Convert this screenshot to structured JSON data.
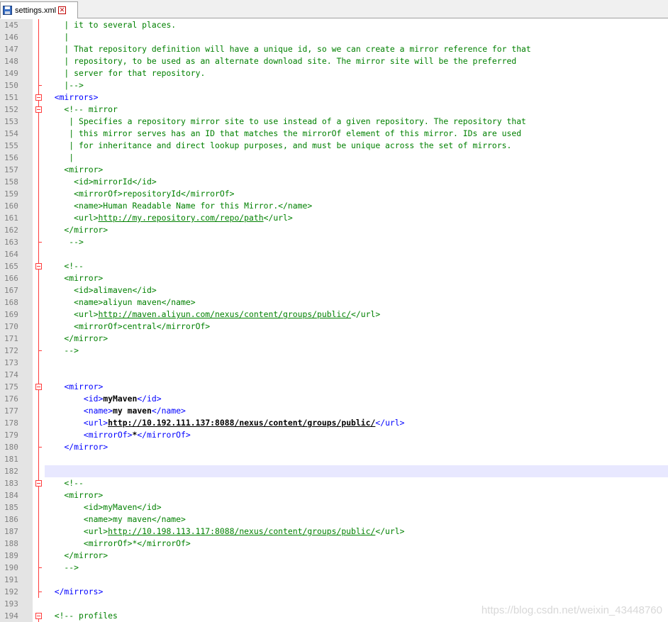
{
  "tab": {
    "filename": "settings.xml",
    "icon": "save-disk-icon",
    "close_icon": "close-icon"
  },
  "watermark": "https://blog.csdn.net/weixin_43448760",
  "colors": {
    "comment": "#008000",
    "tag": "#0000ff",
    "text": "#000000",
    "fold": "#ff3b3b",
    "current_line": "#e8e8ff",
    "gutter_bg": "#e4e4e4",
    "line_number": "#808080"
  },
  "lines": [
    {
      "n": "145",
      "fold": "line",
      "segs": [
        {
          "t": "    | it to several places.",
          "k": "c"
        }
      ]
    },
    {
      "n": "146",
      "fold": "line",
      "segs": [
        {
          "t": "    |",
          "k": "c"
        }
      ]
    },
    {
      "n": "147",
      "fold": "line",
      "segs": [
        {
          "t": "    | That repository definition will have a unique id, so we can create a mirror reference for that",
          "k": "c"
        }
      ]
    },
    {
      "n": "148",
      "fold": "line",
      "segs": [
        {
          "t": "    | repository, to be used as an alternate download site. The mirror site will be the preferred",
          "k": "c"
        }
      ]
    },
    {
      "n": "149",
      "fold": "line",
      "segs": [
        {
          "t": "    | server for that repository.",
          "k": "c"
        }
      ]
    },
    {
      "n": "150",
      "fold": "end",
      "segs": [
        {
          "t": "    |-->",
          "k": "c"
        }
      ]
    },
    {
      "n": "151",
      "fold": "box",
      "segs": [
        {
          "t": "  ",
          "k": "c"
        },
        {
          "t": "<mirrors>",
          "k": "tag"
        }
      ]
    },
    {
      "n": "152",
      "fold": "box",
      "segs": [
        {
          "t": "    <!-- mirror",
          "k": "c"
        }
      ]
    },
    {
      "n": "153",
      "fold": "line",
      "segs": [
        {
          "t": "     | Specifies a repository mirror site to use instead of a given repository. The repository that",
          "k": "c"
        }
      ]
    },
    {
      "n": "154",
      "fold": "line",
      "segs": [
        {
          "t": "     | this mirror serves has an ID that matches the mirrorOf element of this mirror. IDs are used",
          "k": "c"
        }
      ]
    },
    {
      "n": "155",
      "fold": "line",
      "segs": [
        {
          "t": "     | for inheritance and direct lookup purposes, and must be unique across the set of mirrors.",
          "k": "c"
        }
      ]
    },
    {
      "n": "156",
      "fold": "line",
      "segs": [
        {
          "t": "     |",
          "k": "c"
        }
      ]
    },
    {
      "n": "157",
      "fold": "line",
      "segs": [
        {
          "t": "    <mirror>",
          "k": "c"
        }
      ]
    },
    {
      "n": "158",
      "fold": "line",
      "segs": [
        {
          "t": "      <id>mirrorId</id>",
          "k": "c"
        }
      ]
    },
    {
      "n": "159",
      "fold": "line",
      "segs": [
        {
          "t": "      <mirrorOf>repositoryId</mirrorOf>",
          "k": "c"
        }
      ]
    },
    {
      "n": "160",
      "fold": "line",
      "segs": [
        {
          "t": "      <name>Human Readable Name for this Mirror.</name>",
          "k": "c"
        }
      ]
    },
    {
      "n": "161",
      "fold": "line",
      "segs": [
        {
          "t": "      <url>",
          "k": "c"
        },
        {
          "t": "http://my.repository.com/repo/path",
          "k": "curl"
        },
        {
          "t": "</url>",
          "k": "c"
        }
      ]
    },
    {
      "n": "162",
      "fold": "line",
      "segs": [
        {
          "t": "    </mirror>",
          "k": "c"
        }
      ]
    },
    {
      "n": "163",
      "fold": "end",
      "segs": [
        {
          "t": "     -->",
          "k": "c"
        }
      ]
    },
    {
      "n": "164",
      "fold": "line",
      "segs": [
        {
          "t": "",
          "k": "c"
        }
      ]
    },
    {
      "n": "165",
      "fold": "box",
      "segs": [
        {
          "t": "    <!--",
          "k": "c"
        }
      ]
    },
    {
      "n": "166",
      "fold": "line",
      "segs": [
        {
          "t": "    <mirror>",
          "k": "c"
        }
      ]
    },
    {
      "n": "167",
      "fold": "line",
      "segs": [
        {
          "t": "      <id>alimaven</id>",
          "k": "c"
        }
      ]
    },
    {
      "n": "168",
      "fold": "line",
      "segs": [
        {
          "t": "      <name>aliyun maven</name>",
          "k": "c"
        }
      ]
    },
    {
      "n": "169",
      "fold": "line",
      "segs": [
        {
          "t": "      <url>",
          "k": "c"
        },
        {
          "t": "http://maven.aliyun.com/nexus/content/groups/public/",
          "k": "curl"
        },
        {
          "t": "</url>",
          "k": "c"
        }
      ]
    },
    {
      "n": "170",
      "fold": "line",
      "segs": [
        {
          "t": "      <mirrorOf>central</mirrorOf>",
          "k": "c"
        }
      ]
    },
    {
      "n": "171",
      "fold": "line",
      "segs": [
        {
          "t": "    </mirror>",
          "k": "c"
        }
      ]
    },
    {
      "n": "172",
      "fold": "end",
      "segs": [
        {
          "t": "    -->",
          "k": "c"
        }
      ]
    },
    {
      "n": "173",
      "fold": "line",
      "segs": [
        {
          "t": "",
          "k": "c"
        }
      ]
    },
    {
      "n": "174",
      "fold": "line",
      "segs": [
        {
          "t": "",
          "k": "c"
        }
      ]
    },
    {
      "n": "175",
      "fold": "box",
      "segs": [
        {
          "t": "    ",
          "k": "c"
        },
        {
          "t": "<mirror>",
          "k": "tag"
        }
      ]
    },
    {
      "n": "176",
      "fold": "line",
      "segs": [
        {
          "t": "        ",
          "k": "c"
        },
        {
          "t": "<id>",
          "k": "tag"
        },
        {
          "t": "myMaven",
          "k": "txt"
        },
        {
          "t": "</id>",
          "k": "tag"
        }
      ]
    },
    {
      "n": "177",
      "fold": "line",
      "segs": [
        {
          "t": "        ",
          "k": "c"
        },
        {
          "t": "<name>",
          "k": "tag"
        },
        {
          "t": "my maven",
          "k": "txt"
        },
        {
          "t": "</name>",
          "k": "tag"
        }
      ]
    },
    {
      "n": "178",
      "fold": "line",
      "segs": [
        {
          "t": "        ",
          "k": "c"
        },
        {
          "t": "<url>",
          "k": "tag"
        },
        {
          "t": "http://10.192.111.137:8088/nexus/content/groups/public/",
          "k": "url"
        },
        {
          "t": "</url>",
          "k": "tag"
        }
      ]
    },
    {
      "n": "179",
      "fold": "line",
      "segs": [
        {
          "t": "        ",
          "k": "c"
        },
        {
          "t": "<mirrorOf>",
          "k": "tag"
        },
        {
          "t": "*",
          "k": "txt"
        },
        {
          "t": "</mirrorOf>",
          "k": "tag"
        }
      ]
    },
    {
      "n": "180",
      "fold": "end",
      "segs": [
        {
          "t": "    ",
          "k": "c"
        },
        {
          "t": "</mirror>",
          "k": "tag"
        }
      ]
    },
    {
      "n": "181",
      "fold": "line",
      "segs": [
        {
          "t": "",
          "k": "c"
        }
      ]
    },
    {
      "n": "182",
      "fold": "line",
      "current": true,
      "segs": [
        {
          "t": "",
          "k": "c"
        }
      ]
    },
    {
      "n": "183",
      "fold": "box",
      "segs": [
        {
          "t": "    <!--",
          "k": "c"
        }
      ]
    },
    {
      "n": "184",
      "fold": "line",
      "segs": [
        {
          "t": "    <mirror>",
          "k": "c"
        }
      ]
    },
    {
      "n": "185",
      "fold": "line",
      "segs": [
        {
          "t": "        <id>myMaven</id>",
          "k": "c"
        }
      ]
    },
    {
      "n": "186",
      "fold": "line",
      "segs": [
        {
          "t": "        <name>my maven</name>",
          "k": "c"
        }
      ]
    },
    {
      "n": "187",
      "fold": "line",
      "segs": [
        {
          "t": "        <url>",
          "k": "c"
        },
        {
          "t": "http://10.198.113.117:8088/nexus/content/groups/public/",
          "k": "curl"
        },
        {
          "t": "</url>",
          "k": "c"
        }
      ]
    },
    {
      "n": "188",
      "fold": "line",
      "segs": [
        {
          "t": "        <mirrorOf>*</mirrorOf>",
          "k": "c"
        }
      ]
    },
    {
      "n": "189",
      "fold": "line",
      "segs": [
        {
          "t": "    </mirror>",
          "k": "c"
        }
      ]
    },
    {
      "n": "190",
      "fold": "end",
      "segs": [
        {
          "t": "    -->",
          "k": "c"
        }
      ]
    },
    {
      "n": "191",
      "fold": "line",
      "segs": [
        {
          "t": "",
          "k": "c"
        }
      ]
    },
    {
      "n": "192",
      "fold": "end",
      "segs": [
        {
          "t": "  ",
          "k": "c"
        },
        {
          "t": "</mirrors>",
          "k": "tag"
        }
      ]
    },
    {
      "n": "193",
      "fold": "none",
      "segs": [
        {
          "t": "",
          "k": "c"
        }
      ]
    },
    {
      "n": "194",
      "fold": "box",
      "segs": [
        {
          "t": "  <!-- profiles",
          "k": "c"
        }
      ]
    }
  ]
}
